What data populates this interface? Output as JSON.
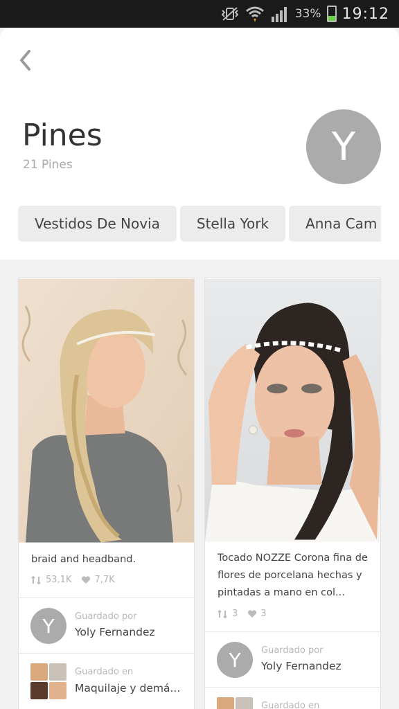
{
  "status_bar": {
    "battery_pct": "33%",
    "time": "19:12"
  },
  "header": {
    "title": "Pines",
    "count": "21 Pines",
    "avatar_letter": "Y"
  },
  "chips": [
    "Vestidos De Novia",
    "Stella York",
    "Anna Cam"
  ],
  "pins": [
    {
      "caption": "braid and headband.",
      "repins": "53,1K",
      "likes": "7,7K",
      "saved_by_label": "Guardado por",
      "saved_by_name": "Yoly Fernandez",
      "avatar_letter": "Y",
      "saved_in_label": "Guardado en",
      "saved_in_board": "Maquilaje y demá..."
    },
    {
      "caption_lines": [
        "Tocado NOZZE Corona fina de",
        "flores de porcelana hechas y",
        "pintadas a mano en col..."
      ],
      "repins": "3",
      "likes": "3",
      "saved_by_label": "Guardado por",
      "saved_by_name": "Yoly Fernandez",
      "avatar_letter": "Y",
      "saved_in_label": "Guardado en"
    }
  ],
  "colors": {
    "background": "#f1f1f1",
    "avatar": "#ababab",
    "status_bar": "#1a1a1a"
  }
}
